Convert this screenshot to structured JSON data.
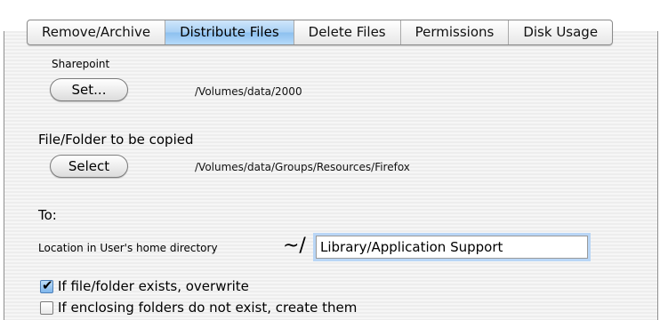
{
  "tabs": [
    {
      "label": "Remove/Archive",
      "active": false
    },
    {
      "label": "Distribute Files",
      "active": true
    },
    {
      "label": "Delete Files",
      "active": false
    },
    {
      "label": "Permissions",
      "active": false
    },
    {
      "label": "Disk Usage",
      "active": false
    }
  ],
  "sharepoint": {
    "label": "Sharepoint",
    "button_label": "Set...",
    "path": "/Volumes/data/2000"
  },
  "copy_source": {
    "label": "File/Folder to be copied",
    "button_label": "Select",
    "path": "/Volumes/data/Groups/Resources/Firefox"
  },
  "destination": {
    "label": "To:",
    "location_label": "Location in User's home directory",
    "prefix": "~/",
    "value": "Library/Application Support"
  },
  "options": [
    {
      "label": "If file/folder exists, overwrite",
      "checked": true
    },
    {
      "label": "If enclosing folders do not exist, create them",
      "checked": false
    }
  ],
  "colors": {
    "active_tab": "#9ccaf2",
    "focus_ring": "#b9d6f6",
    "checkbox_checked": "#7fb6ec"
  }
}
